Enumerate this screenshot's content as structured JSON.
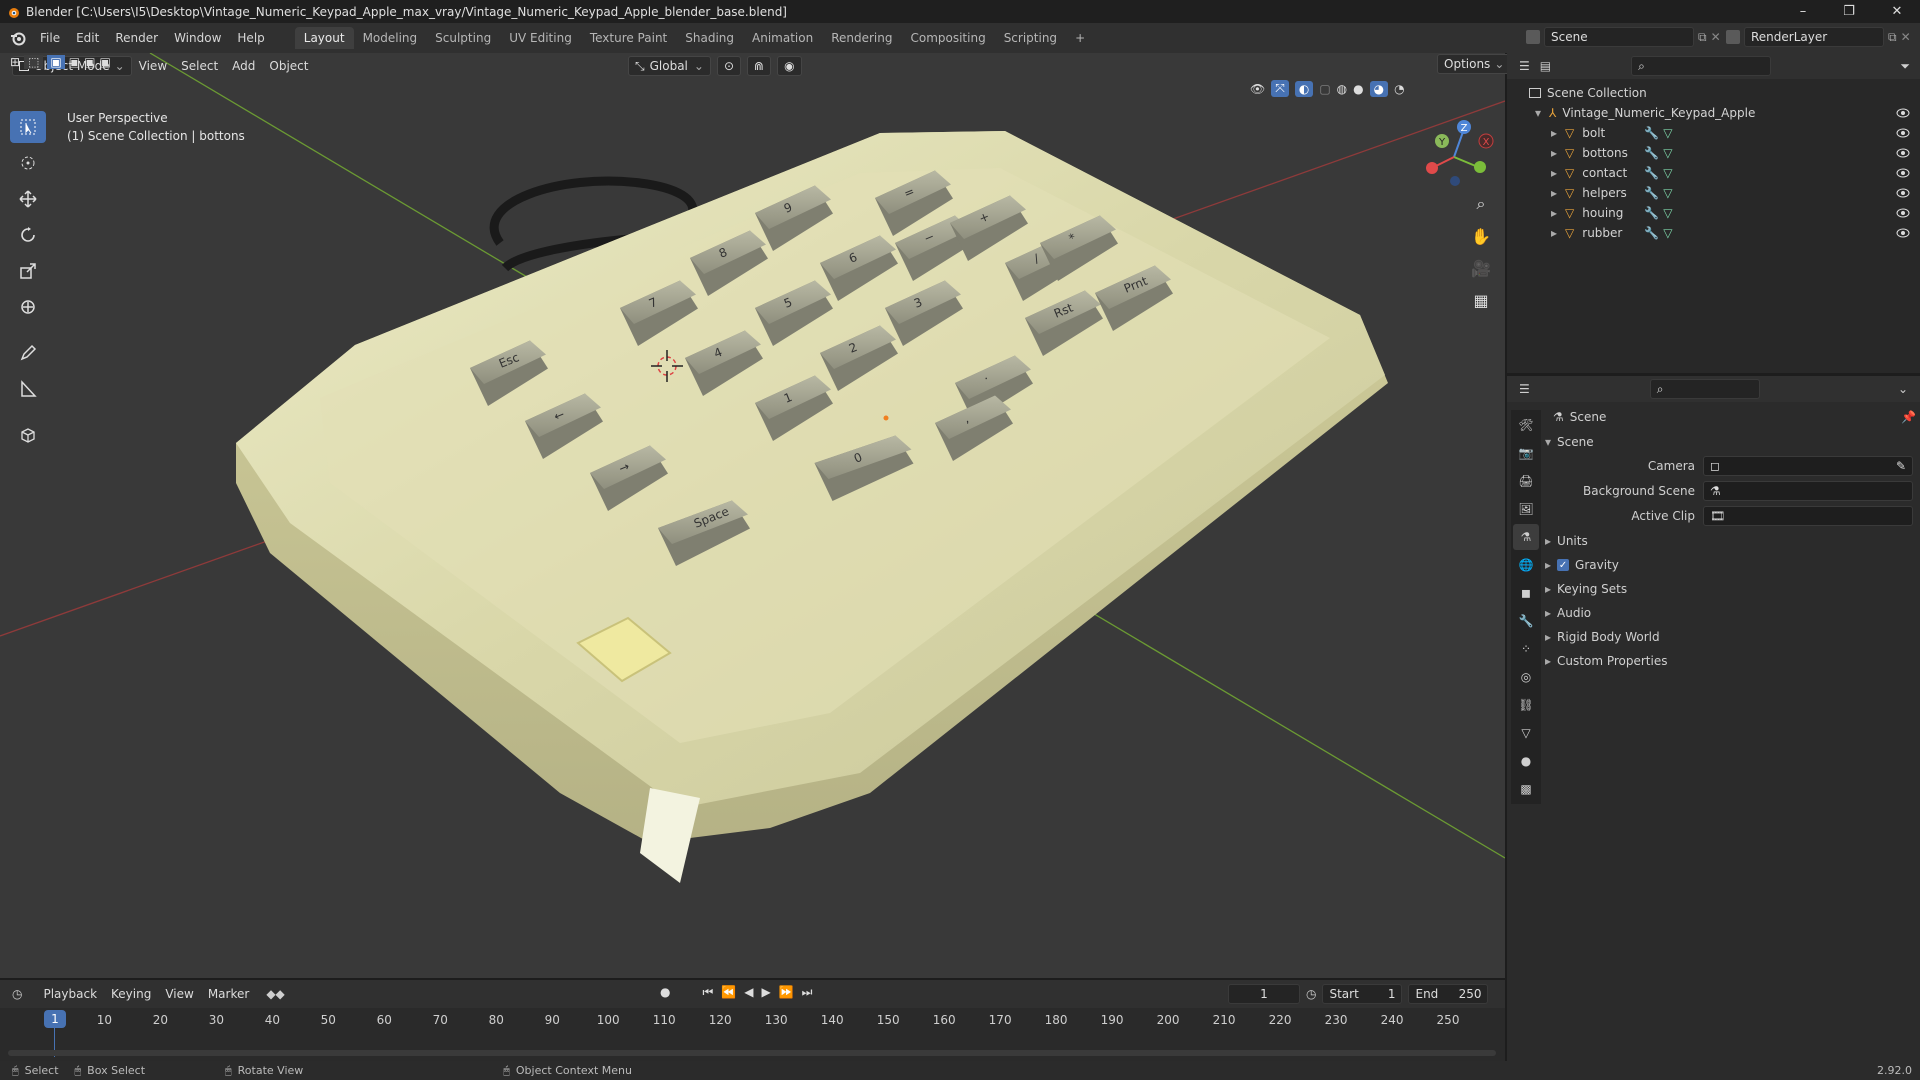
{
  "window": {
    "title": "Blender [C:\\Users\\I5\\Desktop\\Vintage_Numeric_Keypad_Apple_max_vray/Vintage_Numeric_Keypad_Apple_blender_base.blend]",
    "minimize": "–",
    "maximize": "❐",
    "close": "✕"
  },
  "menu": [
    "File",
    "Edit",
    "Render",
    "Window",
    "Help"
  ],
  "workspaces": [
    "Layout",
    "Modeling",
    "Sculpting",
    "UV Editing",
    "Texture Paint",
    "Shading",
    "Animation",
    "Rendering",
    "Compositing",
    "Scripting",
    "+"
  ],
  "active_workspace": "Layout",
  "scene_field": "Scene",
  "render_layer_field": "RenderLayer",
  "viewport": {
    "mode": "Object Mode",
    "menus": [
      "View",
      "Select",
      "Add",
      "Object"
    ],
    "transform_orientation": "Global",
    "options": "Options",
    "overlay_title": "User Perspective",
    "overlay_sub": "(1) Scene Collection | bottons"
  },
  "gizmo": {
    "x": "X",
    "y": "Y",
    "z": "Z"
  },
  "key_labels": [
    "Esc",
    "←",
    "→",
    "Space",
    "7",
    "8",
    "9",
    "4",
    "5",
    "6",
    "1",
    "2",
    "3",
    "0",
    "−",
    "+",
    "·",
    "Rst",
    "Prnt",
    ",",
    "/",
    "*",
    "="
  ],
  "outliner": {
    "root": "Scene Collection",
    "collection": "Vintage_Numeric_Keypad_Apple",
    "items": [
      "bolt",
      "bottons",
      "contact",
      "helpers",
      "houing",
      "rubber"
    ]
  },
  "properties": {
    "header": "Scene",
    "section": "Scene",
    "fields": [
      {
        "label": "Camera"
      },
      {
        "label": "Background Scene"
      },
      {
        "label": "Active Clip"
      }
    ],
    "panels": [
      "Units",
      "Gravity",
      "Keying Sets",
      "Audio",
      "Rigid Body World",
      "Custom Properties"
    ],
    "gravity_checked": true
  },
  "timeline": {
    "menus": [
      "Playback",
      "Keying",
      "View",
      "Marker"
    ],
    "current_frame": "1",
    "start_label": "Start",
    "start": "1",
    "end_label": "End",
    "end": "250",
    "ticks": [
      "1",
      "10",
      "20",
      "30",
      "40",
      "50",
      "60",
      "70",
      "80",
      "90",
      "100",
      "110",
      "120",
      "130",
      "140",
      "150",
      "160",
      "170",
      "180",
      "190",
      "200",
      "210",
      "220",
      "230",
      "240",
      "250"
    ]
  },
  "status": {
    "select": "Select",
    "box_select": "Box Select",
    "rotate": "Rotate View",
    "context": "Object Context Menu",
    "version": "2.92.0"
  },
  "colors": {
    "accent": "#4772b3",
    "keypad": "#d8d6a8",
    "key": "#a9a995",
    "grid_x": "#9b3a3a",
    "grid_y": "#6a9a2e"
  }
}
